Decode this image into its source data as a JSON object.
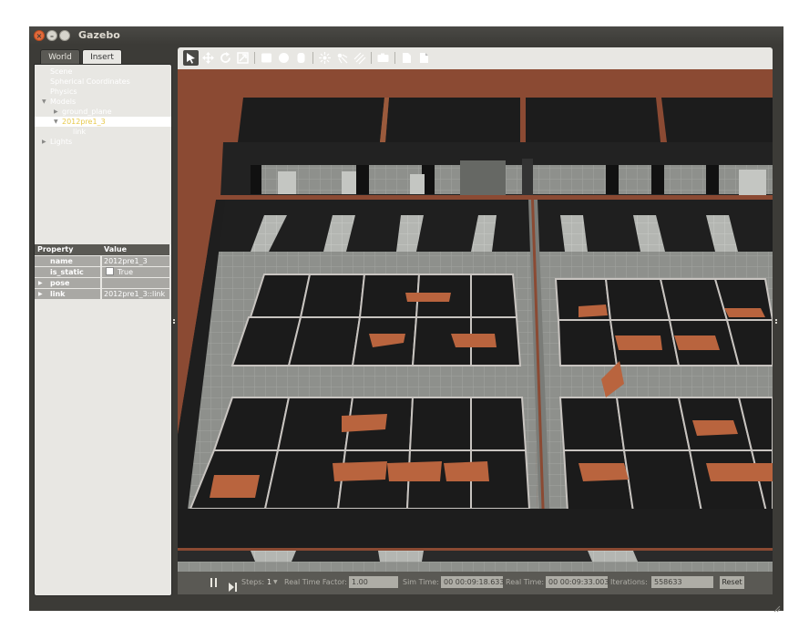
{
  "window": {
    "title": "Gazebo"
  },
  "left_panel": {
    "tabs": [
      {
        "label": "World",
        "active": true
      },
      {
        "label": "Insert",
        "active": false
      }
    ],
    "tree": [
      {
        "label": "Scene"
      },
      {
        "label": "Spherical Coordinates"
      },
      {
        "label": "Physics"
      },
      {
        "label": "Models"
      },
      {
        "label": "ground_plane"
      },
      {
        "label": "2012pre1_3"
      },
      {
        "label": "link"
      },
      {
        "label": "Lights"
      }
    ],
    "properties": {
      "header": {
        "property": "Property",
        "value": "Value"
      },
      "rows": [
        {
          "key": "name",
          "value": "2012pre1_3"
        },
        {
          "key": "is_static",
          "value": "True"
        },
        {
          "key": "pose",
          "value": ""
        },
        {
          "key": "link",
          "value": "2012pre1_3::link"
        }
      ]
    }
  },
  "toolbar": {
    "icons": [
      "select-arrow-icon",
      "translate-icon",
      "rotate-icon",
      "scale-icon",
      "box-icon",
      "sphere-icon",
      "cylinder-icon",
      "point-light-icon",
      "spot-light-icon",
      "directional-light-icon",
      "screenshot-icon",
      "copy-icon",
      "paste-icon"
    ]
  },
  "bottom_bar": {
    "steps_label": "Steps:",
    "steps_value": "1",
    "rtf_label": "Real Time Factor:",
    "rtf_value": "1.00",
    "sim_time_label": "Sim Time:",
    "sim_time_value": "00 00:09:18.633",
    "real_time_label": "Real Time:",
    "real_time_value": "00 00:09:33.003",
    "iterations_label": "Iterations:",
    "iterations_value": "558633",
    "reset_label": "Reset"
  },
  "colors": {
    "floor_brown": "#8b4a33",
    "panel_bg": "#e8e7e3",
    "window_dark": "#3c3b37",
    "selection_text": "#e7c94b"
  }
}
